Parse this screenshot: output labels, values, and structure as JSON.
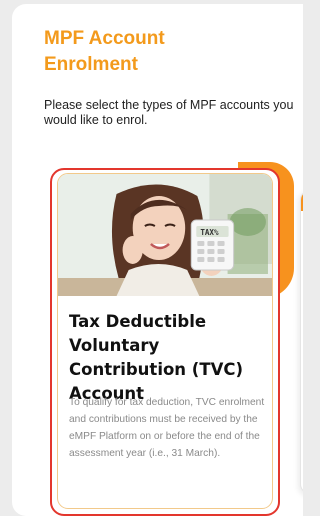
{
  "page": {
    "title": "MPF Account\nEnrolment",
    "subtitle": "Please select the types of MPF accounts you would like to enrol."
  },
  "cards": [
    {
      "title": "Tax Deductible Voluntary Contribution (TVC) Account",
      "description": "To qualify for tax deduction, TVC enrolment and contributions must be received by the eMPF Platform on or before the end of the assessment year (i.e., 31 March).",
      "image_label": "TAX%",
      "selected": true
    }
  ],
  "colors": {
    "accent": "#f39a1c",
    "selected_border": "#e3362d",
    "card_inner_border": "#f2c98a"
  },
  "icons": {
    "card_image": "woman-with-calculator-photo"
  }
}
